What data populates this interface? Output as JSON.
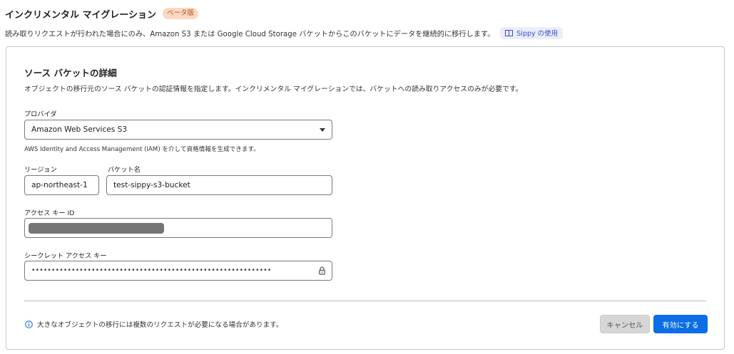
{
  "header": {
    "title": "インクリメンタル マイグレーション",
    "badge": "ベータ版",
    "description": "読み取りリクエストが行われた場合にのみ、Amazon S3 または Google Cloud Storage バケットからこのバケットにデータを継続的に移行します。",
    "doc_link": "Sippy の使用"
  },
  "card": {
    "title": "ソース バケットの詳細",
    "description": "オブジェクトの移行元のソース バケットの認証情報を指定します。インクリメンタル マイグレーションでは、バケットへの読み取りアクセスのみが必要です。",
    "provider": {
      "label": "プロバイダ",
      "value": "Amazon Web Services S3",
      "help": "AWS Identity and Access Management (IAM) を介して資格情報を生成できます。"
    },
    "region": {
      "label": "リージョン",
      "value": "ap-northeast-1"
    },
    "bucket": {
      "label": "バケット名",
      "value": "test-sippy-s3-bucket"
    },
    "access_key": {
      "label": "アクセス キー ID",
      "value": ""
    },
    "secret_key": {
      "label": "シークレット アクセス キー",
      "value": "••••••••••••••••••••••••••••••••••••••••••••••••••••••••••••"
    },
    "note": "大きなオブジェクトの移行には複数のリクエストが必要になる場合があります。",
    "buttons": {
      "cancel": "キャンセル",
      "enable": "有効にする"
    }
  },
  "colors": {
    "accent": "#0b6de8",
    "badge_bg": "#fbd8c2",
    "badge_text": "#b4541b",
    "link_bg": "#ecedfb",
    "link_text": "#3c4ad2"
  },
  "icons": [
    "book-icon",
    "chevron-down-icon",
    "lock-icon",
    "info-icon"
  ]
}
